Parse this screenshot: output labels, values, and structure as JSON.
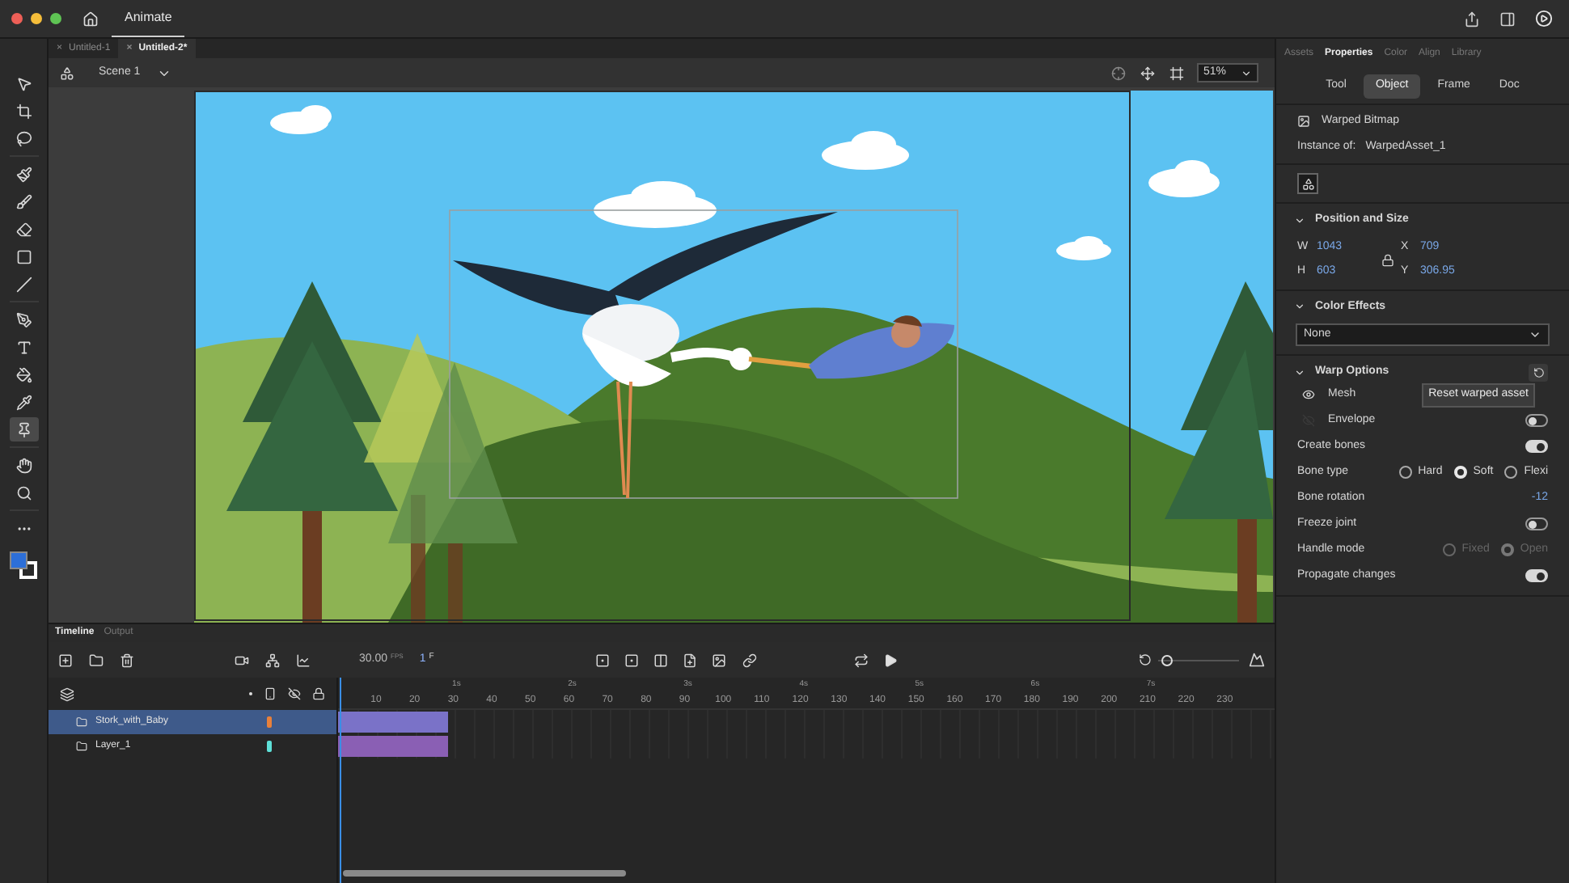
{
  "app": {
    "title": "Animate"
  },
  "doc_tabs": [
    {
      "close": "×",
      "label": "Untitled-1",
      "selected": false
    },
    {
      "close": "×",
      "label": "Untitled-2*",
      "selected": true
    }
  ],
  "scene": {
    "label": "Scene 1"
  },
  "zoom": {
    "value": "51%"
  },
  "tools": [
    {
      "selected": false
    },
    {
      "selected": false
    },
    {
      "selected": false
    },
    {
      "selected": false
    },
    {
      "selected": false
    },
    {
      "selected": false
    },
    {
      "selected": false
    },
    {
      "selected": false
    },
    {
      "selected": false
    },
    {
      "selected": false
    },
    {
      "selected": false
    },
    {
      "selected": false
    },
    {
      "selected": true
    },
    {
      "selected": false
    },
    {
      "selected": false
    },
    {
      "selected": false
    }
  ],
  "panel_tabs": [
    {
      "label": "Assets",
      "selected": false
    },
    {
      "label": "Properties",
      "selected": true
    },
    {
      "label": "Color",
      "selected": false
    },
    {
      "label": "Align",
      "selected": false
    },
    {
      "label": "Library",
      "selected": false
    }
  ],
  "object_tabs": [
    {
      "label": "Tool",
      "selected": false
    },
    {
      "label": "Object",
      "selected": true
    },
    {
      "label": "Frame",
      "selected": false
    },
    {
      "label": "Doc",
      "selected": false
    }
  ],
  "object": {
    "type": "Warped Bitmap",
    "instance_label": "Instance of:",
    "instance": "WarpedAsset_1"
  },
  "position_size": {
    "title": "Position and Size",
    "fields": [
      {
        "label": "W",
        "value": "1043"
      },
      {
        "label": "H",
        "value": "603"
      },
      {
        "label": "X",
        "value": "709"
      },
      {
        "label": "Y",
        "value": "306.95"
      }
    ]
  },
  "color_effects": {
    "title": "Color Effects",
    "value": "None"
  },
  "warp": {
    "title": "Warp Options",
    "tooltip": "Reset warped asset",
    "rows": [
      {
        "kind": "layer",
        "label": "Mesh",
        "visible": true
      },
      {
        "kind": "layer",
        "label": "Envelope",
        "visible": false,
        "on": false
      },
      {
        "kind": "toggle",
        "label": "Create bones",
        "on": true
      },
      {
        "kind": "radio",
        "label": "Bone type",
        "disabled": false,
        "options": [
          {
            "label": "Hard",
            "selected": false
          },
          {
            "label": "Soft",
            "selected": true
          },
          {
            "label": "Flexi",
            "selected": false
          }
        ]
      },
      {
        "kind": "value",
        "label": "Bone rotation",
        "value": "-12"
      },
      {
        "kind": "toggle",
        "label": "Freeze joint",
        "on": false
      },
      {
        "kind": "radio",
        "label": "Handle mode",
        "disabled": true,
        "options": [
          {
            "label": "Fixed",
            "selected": false
          },
          {
            "label": "Open",
            "selected": true
          }
        ]
      },
      {
        "kind": "toggle",
        "label": "Propagate changes",
        "on": true
      }
    ]
  },
  "timeline": {
    "tabs": [
      {
        "label": "Timeline",
        "selected": true
      },
      {
        "label": "Output",
        "selected": false
      }
    ],
    "zoom": {
      "level": 0.05
    },
    "fps": "30.00",
    "fps_unit": "FPS",
    "frame": "1",
    "frame_unit": "F",
    "seconds": [
      "1s",
      "2s",
      "3s",
      "4s",
      "5s",
      "6s",
      "7s"
    ],
    "frames": [
      "10",
      "20",
      "30",
      "40",
      "50",
      "60",
      "70",
      "80",
      "90",
      "100",
      "110",
      "120",
      "130",
      "140",
      "150",
      "160",
      "170",
      "180",
      "190",
      "200",
      "210",
      "220",
      "230"
    ],
    "layers": [
      {
        "name": "Stork_with_Baby",
        "selected": true,
        "color": "#e8803a"
      },
      {
        "name": "Layer_1",
        "selected": false,
        "color": "#5ee0d8"
      }
    ]
  }
}
